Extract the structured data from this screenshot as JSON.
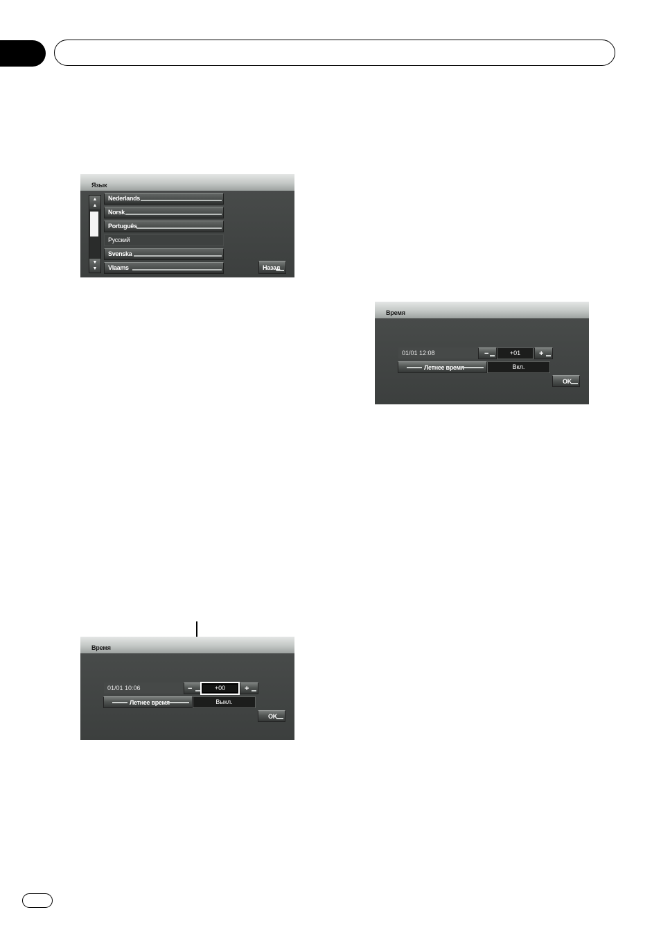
{
  "screen_language": {
    "title": "Язык",
    "items": [
      {
        "label": "Nederlands",
        "selected": false
      },
      {
        "label": "Norsk",
        "selected": false
      },
      {
        "label": "Português",
        "selected": false
      },
      {
        "label": "Русский",
        "selected": true
      },
      {
        "label": "Svenska",
        "selected": false
      },
      {
        "label": "Vlaams",
        "selected": false
      }
    ],
    "back_label": "Назад",
    "scroll_up_icon": "▲\n▲",
    "scroll_down_icon": "▼\n▼"
  },
  "screen_time_on": {
    "title": "Время",
    "datetime": "01/01 12:08",
    "offset": "+01",
    "minus_label": "−",
    "plus_label": "+",
    "dst_label": "Летнее время",
    "dst_value": "Вкл.",
    "ok_label": "OK"
  },
  "screen_time_off": {
    "title": "Время",
    "datetime": "01/01 10:06",
    "offset": "+00",
    "minus_label": "−",
    "plus_label": "+",
    "dst_label": "Летнее время",
    "dst_value": "Выкл.",
    "ok_label": "OK"
  }
}
